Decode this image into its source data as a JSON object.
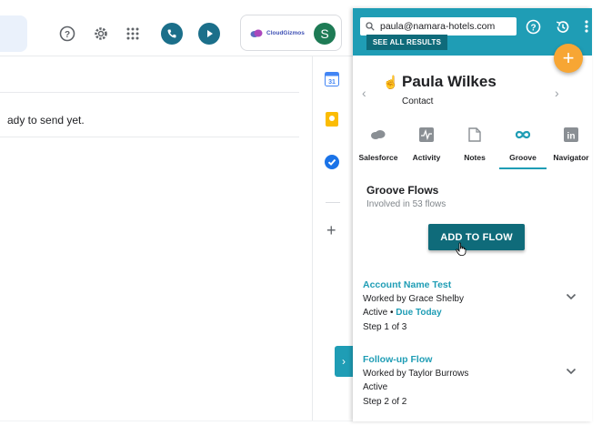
{
  "gmail": {
    "draft_snippet": "ady to send yet.",
    "brand_name": "CloudGizmos",
    "avatar_initial": "S"
  },
  "groove": {
    "search": {
      "value": "paula@namara-hotels.com"
    },
    "see_all_label": "SEE ALL RESULTS",
    "fab_label": "+",
    "contact": {
      "name": "Paula Wilkes",
      "type": "Contact"
    },
    "tabs": [
      {
        "label": "Salesforce",
        "icon": "salesforce-icon"
      },
      {
        "label": "Activity",
        "icon": "activity-icon"
      },
      {
        "label": "Notes",
        "icon": "notes-icon"
      },
      {
        "label": "Groove",
        "icon": "groove-icon",
        "active": true
      },
      {
        "label": "Navigator",
        "icon": "linkedin-icon"
      }
    ],
    "section_title": "Groove Flows",
    "section_subtitle": "Involved in 53 flows",
    "add_button": "ADD TO FLOW",
    "flows": [
      {
        "name": "Account Name Test",
        "worked_by": "Worked by Grace Shelby",
        "status": "Active",
        "due": "Due Today",
        "step": "Step 1 of 3"
      },
      {
        "name": "Follow-up Flow",
        "worked_by": "Worked by Taylor Burrows",
        "status": "Active",
        "step": "Step 2 of 2"
      }
    ]
  },
  "colors": {
    "accent": "#1f9db5",
    "button": "#0f6b7a",
    "fab": "#f7a634"
  }
}
